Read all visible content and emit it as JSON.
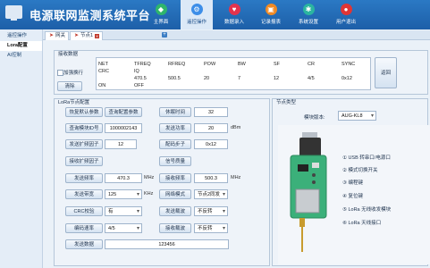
{
  "app": {
    "title": "电源联网监测系统平台"
  },
  "nav": [
    {
      "label": "主界面",
      "icon": "shield-icon",
      "color": "#2fb56c"
    },
    {
      "label": "遥控操作",
      "icon": "gear-icon",
      "color": "#3d8ee8"
    },
    {
      "label": "数据录入",
      "icon": "heart-icon",
      "color": "#e2334d"
    },
    {
      "label": "记录报表",
      "icon": "calendar-icon",
      "color": "#f08a24"
    },
    {
      "label": "系统设置",
      "icon": "settings-icon",
      "color": "#2bb5a0"
    },
    {
      "label": "用户退出",
      "icon": "user-icon",
      "color": "#e03535"
    }
  ],
  "sidebar": {
    "items": [
      "遥控操作",
      "Lora配置",
      "AI控制"
    ]
  },
  "tabs": [
    {
      "label": "网关"
    },
    {
      "label": "节点1"
    }
  ],
  "receive": {
    "title": "接收数据",
    "hex_label": "加强换行",
    "clear_label": "清除",
    "back_label": "返回",
    "rows": [
      [
        "NET",
        "TFREQ",
        "RFREQ",
        "POW",
        "BW",
        "SF",
        "CR",
        "SYNC"
      ],
      [
        "CRC",
        "IQ",
        "",
        "",
        "",
        "",
        "",
        ""
      ],
      [
        "ON",
        "OFF",
        "470.5",
        "500.5",
        "20",
        "7",
        "12",
        "4/5",
        "0x12"
      ]
    ]
  },
  "lora": {
    "title": "LoRa节点配置",
    "restore_defaults": "恢复默认参数",
    "query_config": "查询配置参数",
    "query_module_id": "查询模块ID号",
    "module_id": "1000002143",
    "send_sf": "发送扩频因子",
    "send_sf_value": "12",
    "recv_sf": "接收扩频因子",
    "send_freq": "发送频率",
    "send_freq_value": "470.3",
    "send_freq_unit": "MHz",
    "send_bw": "发送带宽",
    "send_bw_value": "125",
    "send_bw_unit": "KHz",
    "crc_label": "CRC校验",
    "crc_value": "有",
    "code_rate": "编码速率",
    "code_rate_value": "4/5",
    "send_data": "发送数据",
    "send_data_value": "123456",
    "sleep_time": "休眠时间",
    "sleep_time_value": "32",
    "send_power": "发送功率",
    "send_power_value": "20",
    "send_power_unit": "dBm",
    "sync_word": "配码步子",
    "sync_word_value": "0x12",
    "signal_strength": "信号质量",
    "recv_freq": "接收频率",
    "recv_freq_value": "500.3",
    "recv_freq_unit": "MHz",
    "network_mode": "网络模式",
    "network_mode_value": "节点2同发",
    "send_invert": "发送载波",
    "send_invert_value": "不反转",
    "recv_invert": "接收载波",
    "recv_invert_value": "不反转"
  },
  "node_type": {
    "title": "节点类型",
    "module_label": "模块版本:",
    "module_value": "AUG-KL8",
    "callouts": [
      "① USB 转串口/电源口",
      "② 模式切换开关",
      "③ 编程键",
      "④ 复位键",
      "⑤ LoRa 无线收发模块",
      "⑥ LoRa 天线接口"
    ]
  }
}
